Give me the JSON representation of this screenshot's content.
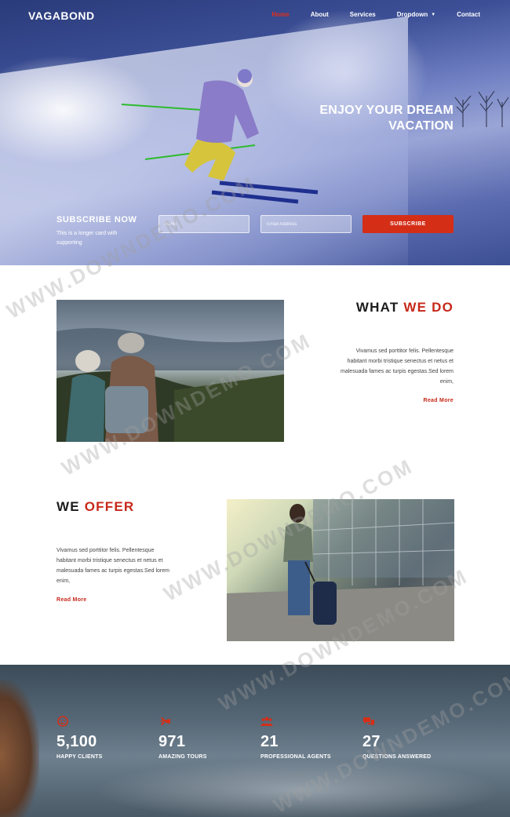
{
  "brand": {
    "logo": "VAGABOND",
    "accent_color": "#d42e17"
  },
  "nav": {
    "items": [
      {
        "label": "Home",
        "active": true
      },
      {
        "label": "About",
        "active": false
      },
      {
        "label": "Services",
        "active": false
      },
      {
        "label": "Dropdown",
        "active": false,
        "has_caret": true
      },
      {
        "label": "Contact",
        "active": false
      }
    ]
  },
  "hero": {
    "title_line1": "ENJOY YOUR DREAM",
    "title_line2": "VACATION",
    "subscribe": {
      "title": "SUBSCRIBE NOW",
      "text": "This is a longer card with supporting",
      "name_placeholder": "Name",
      "email_placeholder": "Email Address",
      "button_label": "SUBSCRIBE"
    }
  },
  "what_we_do": {
    "title_plain": "WHAT",
    "title_accent": "WE DO",
    "text": "Vivamus sed porttitor felis. Pellentesque habitant morbi tristique senectus et netus et malesuada fames ac turpis egestas.Sed lorem enim,",
    "link_label": "Read More"
  },
  "we_offer": {
    "title_plain": "WE",
    "title_accent": "OFFER",
    "text": "Vivamus sed porttitor felis. Pellentesque habitant morbi tristique senectus et netus et malesuada fames ac turpis egestas.Sed lorem enim,",
    "link_label": "Read More"
  },
  "stats": [
    {
      "icon": "smile-icon",
      "value": "5,100",
      "label": "HAPPY CLIENTS"
    },
    {
      "icon": "plane-icon",
      "value": "971",
      "label": "AMAZING TOURS"
    },
    {
      "icon": "users-icon",
      "value": "21",
      "label": "PROFESSIONAL AGENTS"
    },
    {
      "icon": "comments-icon",
      "value": "27",
      "label": "QUESTIONS ANSWERED"
    }
  ],
  "watermark": "WWW.DOWNDEMO.COM"
}
